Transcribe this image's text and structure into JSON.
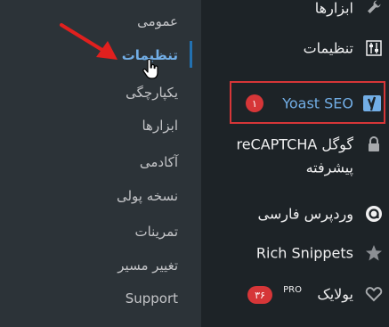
{
  "submenu": {
    "items": [
      {
        "label": "عمومی"
      },
      {
        "label": "تنظیمات",
        "active": true
      },
      {
        "label": "یکپارچگی"
      },
      {
        "label": "ابزارها"
      },
      {
        "label": "آکادمی"
      },
      {
        "label": "نسخه پولی"
      },
      {
        "label": "تمرینات"
      },
      {
        "label": "تغییر مسیر"
      },
      {
        "label": "Support"
      }
    ]
  },
  "main_menu": {
    "items": [
      {
        "label": "ابزارها",
        "icon": "wrench-icon"
      },
      {
        "label": "تنظیمات",
        "icon": "settings-sliders-icon"
      },
      {
        "label": "Yoast SEO",
        "icon": "yoast-icon",
        "badge": "۱"
      },
      {
        "label_line1": "گوگل reCAPTCHA",
        "label_line2": "پیشرفته",
        "icon": "lock-icon"
      },
      {
        "label": "وردپرس فارسی",
        "icon": "wp-persian-icon"
      },
      {
        "label": "Rich Snippets",
        "icon": "star-icon"
      },
      {
        "label": "یولایک",
        "pro": "PRO",
        "badge": "۳۶",
        "icon": "heart-outline-icon"
      }
    ]
  },
  "colors": {
    "sidebar_bg": "#1d2327",
    "submenu_bg": "#2c3338",
    "accent": "#72aee6",
    "highlight": "#d63638"
  }
}
